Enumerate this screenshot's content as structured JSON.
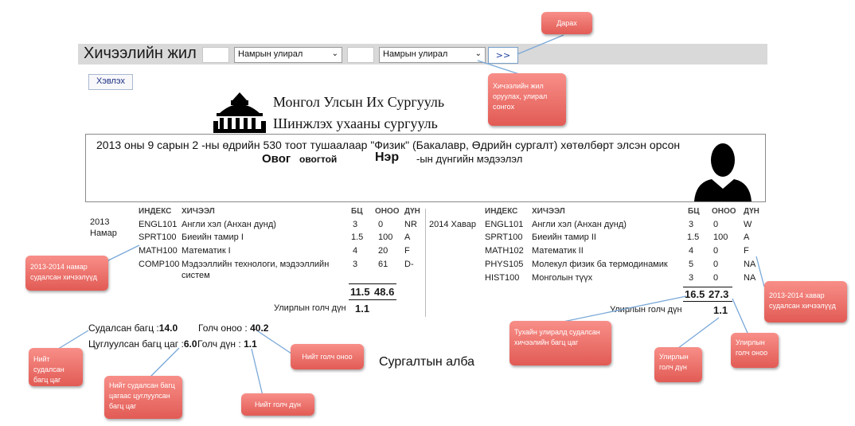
{
  "toolbar": {
    "title": "Хичээлийн жил",
    "semester_select_1": "Намрын улирал",
    "semester_select_2": "Намрын улирал",
    "go_label": ">>",
    "print_label": "Хэвлэх"
  },
  "university": {
    "name": "Монгол Улсын Их Сургууль",
    "school": "Шинжлэх ухааны сургууль"
  },
  "student_info": {
    "description": "2013 оны 9 сарын 2 -ны өдрийн 530 тоот тушаалаар \"Физик\" (Бакалавр, Өдрийн сургалт) хөтөлбөрт элсэн орсон",
    "surname_label": "Овог",
    "surname_value": "овогтой",
    "name_label": "Нэр",
    "suffix": "-ын дүнгийн мэдээлэл"
  },
  "headers": {
    "index": "ИНДЕКС",
    "course": "ХИЧЭЭЛ",
    "credits": "БЦ",
    "score": "ОНОО",
    "grade": "ДҮН"
  },
  "fall": {
    "year": "2013",
    "term": "Намар",
    "rows": [
      {
        "index": "ENGL101",
        "course": "Англи хэл (Анхан дунд)",
        "credits": "3",
        "score": "0",
        "grade": "NR"
      },
      {
        "index": "SPRT100",
        "course": "Биеийн тамир I",
        "credits": "1.5",
        "score": "100",
        "grade": "A"
      },
      {
        "index": "MATH100",
        "course": "Математик I",
        "credits": "4",
        "score": "20",
        "grade": "F"
      },
      {
        "index": "COMP100",
        "course": "Мэдээллийн технологи, мэдээллийн",
        "course2": "систем",
        "credits": "3",
        "score": "61",
        "grade": "D-"
      }
    ],
    "total_credits": "11.5",
    "total_score": "48.6",
    "gpa_label": "Улирлын голч дүн",
    "gpa": "1.1"
  },
  "spring": {
    "term": "2014 Хавар",
    "rows": [
      {
        "index": "ENGL101",
        "course": "Англи хэл (Анхан дунд)",
        "credits": "3",
        "score": "0",
        "grade": "W"
      },
      {
        "index": "SPRT100",
        "course": "Биеийн тамир II",
        "credits": "1.5",
        "score": "100",
        "grade": "A"
      },
      {
        "index": "MATH102",
        "course": "Математик II",
        "credits": "4",
        "score": "0",
        "grade": "F"
      },
      {
        "index": "PHYS105",
        "course": "Молекул физик ба термодинамик",
        "credits": "5",
        "score": "0",
        "grade": "NA"
      },
      {
        "index": "HIST100",
        "course": "Монголын түүх",
        "credits": "3",
        "score": "0",
        "grade": "NA"
      }
    ],
    "total_credits": "16.5",
    "total_score": "27.3",
    "gpa_label": "Улирлын голч дүн",
    "gpa": "1.1"
  },
  "summary": {
    "studied_label": "Судалсан багц :",
    "studied_value": "14.0",
    "avg_score_label": "Голч оноо :",
    "avg_score_value": "40.2",
    "accum_label": "Цуглуулсан багц цаг :",
    "accum_value": "6.0",
    "gpa_label": "Голч дүн :",
    "gpa_value": "1.1",
    "office": "Сургалтын алба"
  },
  "callouts": {
    "press": "Дарах",
    "choose": "Хичээлийн жил оруулах, улирал сонгох",
    "fall_courses": "2013-2014 намар судалсан хичээлүүд",
    "spring_courses": "2013-2014 хавар судалсан хичээлүүд",
    "term_credits": "Тухайн улиралд судалсан хичээлийн багц цаг",
    "term_gpa": "Улирлын голч дүн",
    "term_score": "Улирлын голч оноо",
    "total_credits": "Нийт судалсан багц цаг",
    "accum_credits": "Нийт судалсан багц цагаас цуглуулсан багц цаг",
    "total_score": "Нийт голч оноо",
    "total_gpa": "Нийт голч дүн"
  },
  "colors": {
    "callout": "#e86a64",
    "toolbar_bg": "#d9d9d9"
  }
}
